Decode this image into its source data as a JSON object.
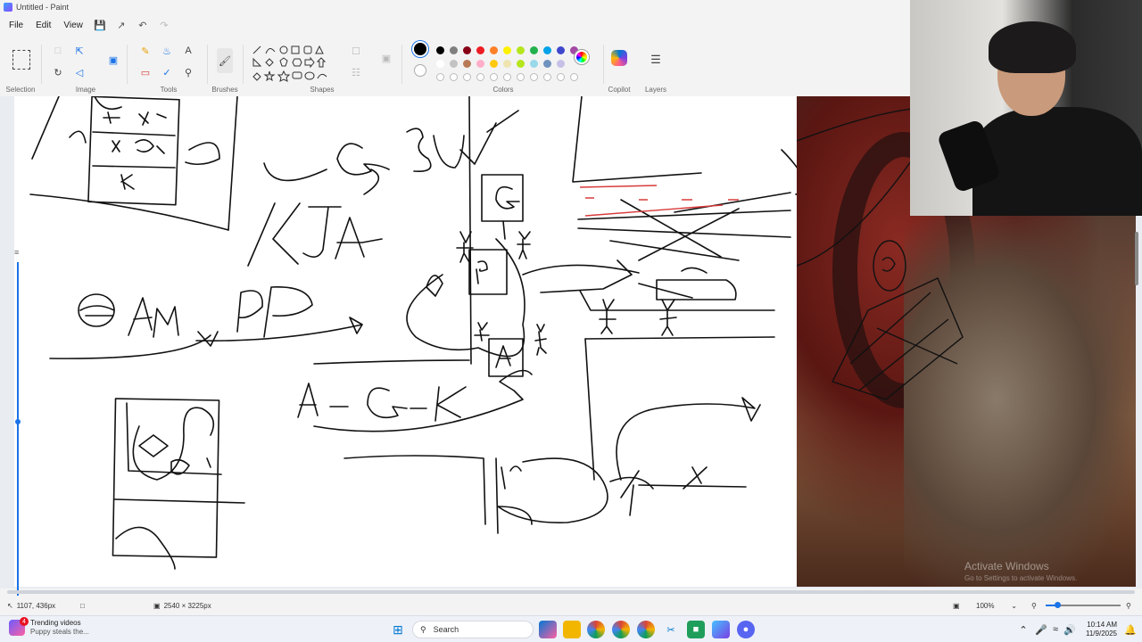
{
  "window": {
    "title": "Untitled - Paint"
  },
  "menu": [
    "File",
    "Edit",
    "View"
  ],
  "ribbon": {
    "groups": [
      "Selection",
      "Image",
      "Tools",
      "Brushes",
      "Shapes",
      "Colors",
      "Copilot",
      "Layers"
    ],
    "colors_row1": [
      "#000000",
      "#7f7f7f",
      "#880015",
      "#ed1c24",
      "#ff7f27",
      "#fff200",
      "#b5e61d",
      "#22b14c",
      "#00a2e8",
      "#3f48cc",
      "#a349a4"
    ],
    "colors_row2": [
      "#ffffff",
      "#c3c3c3",
      "#b97a57",
      "#ffaec9",
      "#ffc90e",
      "#efe4b0",
      "#b5e61d",
      "#99d9ea",
      "#7092be",
      "#c8bfe7"
    ],
    "selected_color": "#000000"
  },
  "canvas": {
    "watermark": "Activate Windows",
    "watermark_sub": "Go to Settings to activate Windows."
  },
  "status": {
    "cursor_pos": "1107, 436px",
    "canvas_size": "2540 × 3225px",
    "zoom": "100%"
  },
  "taskbar": {
    "news_title": "Trending videos",
    "news_sub": "Puppy steals the...",
    "news_badge": "4",
    "search_placeholder": "Search",
    "time": "10:14 AM",
    "date": "11/9/2025"
  }
}
